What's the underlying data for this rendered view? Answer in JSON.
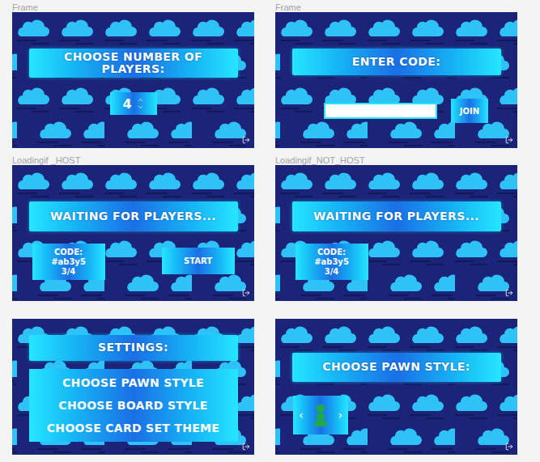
{
  "frames": [
    {
      "kind": "player-count",
      "label": "Frame",
      "title": "CHOOSE NUMBER OF PLAYERS:",
      "value": "4"
    },
    {
      "kind": "join",
      "label": "Frame",
      "title": "ENTER CODE:",
      "input_value": "",
      "button": "JOIN"
    },
    {
      "kind": "waiting",
      "label": "Loadingif _HOST",
      "title": "WAITING FOR PLAYERS...",
      "code_label": "CODE:",
      "code": "#ab3y5",
      "count": "3/4",
      "button": "START"
    },
    {
      "kind": "waiting",
      "label": "Loadingif_NOT_HOST",
      "title": "WAITING FOR PLAYERS...",
      "code_label": "CODE:",
      "code": "#ab3y5",
      "count": "3/4"
    },
    {
      "kind": "settings",
      "title": "SETTINGS:",
      "options": [
        "CHOOSE PAWN STYLE",
        "CHOOSE BOARD STYLE",
        "CHOOSE CARD SET THEME"
      ]
    },
    {
      "kind": "pawn",
      "title": "CHOOSE PAWN STYLE:",
      "prev": "‹",
      "next": "›"
    }
  ]
}
